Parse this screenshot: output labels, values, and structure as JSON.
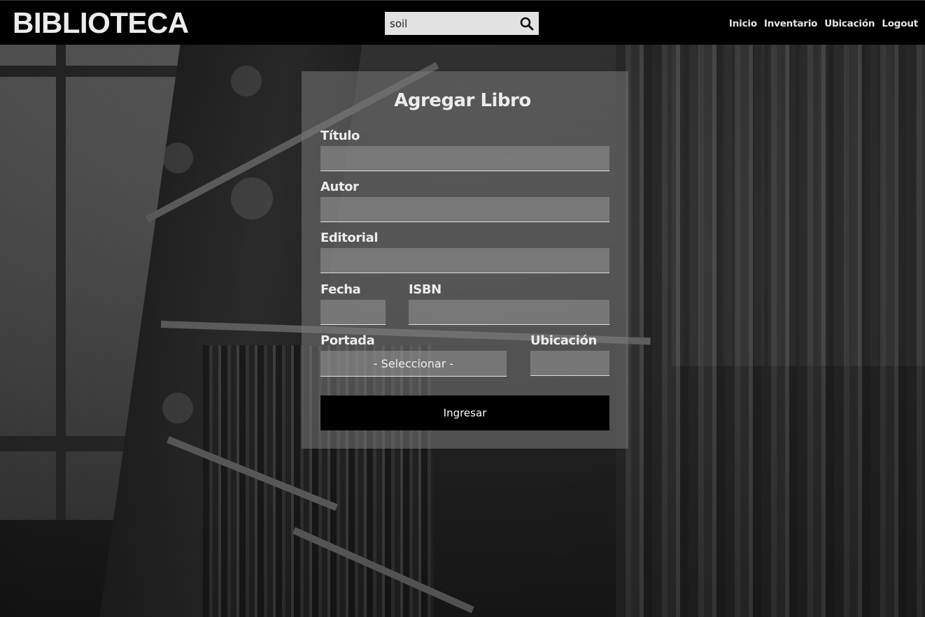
{
  "header": {
    "brand": "BIBLIOTECA",
    "search": {
      "value": "soil"
    },
    "nav": [
      {
        "label": "Inicio"
      },
      {
        "label": "Inventario"
      },
      {
        "label": "Ubicación"
      },
      {
        "label": "Logout"
      }
    ]
  },
  "form": {
    "title": "Agregar Libro",
    "fields": {
      "titulo": {
        "label": "Título",
        "value": ""
      },
      "autor": {
        "label": "Autor",
        "value": ""
      },
      "editorial": {
        "label": "Editorial",
        "value": ""
      },
      "fecha": {
        "label": "Fecha",
        "value": ""
      },
      "isbn": {
        "label": "ISBN",
        "value": ""
      },
      "portada": {
        "label": "Portada",
        "selected": "- Seleccionar -"
      },
      "ubicacion": {
        "label": "Ubicación",
        "value": ""
      }
    },
    "submit_label": "Ingresar"
  },
  "icons": {
    "search": "search-icon"
  },
  "colors": {
    "topbar": "#000000",
    "card": "#787878",
    "button": "#000000",
    "text": "#ececec"
  }
}
